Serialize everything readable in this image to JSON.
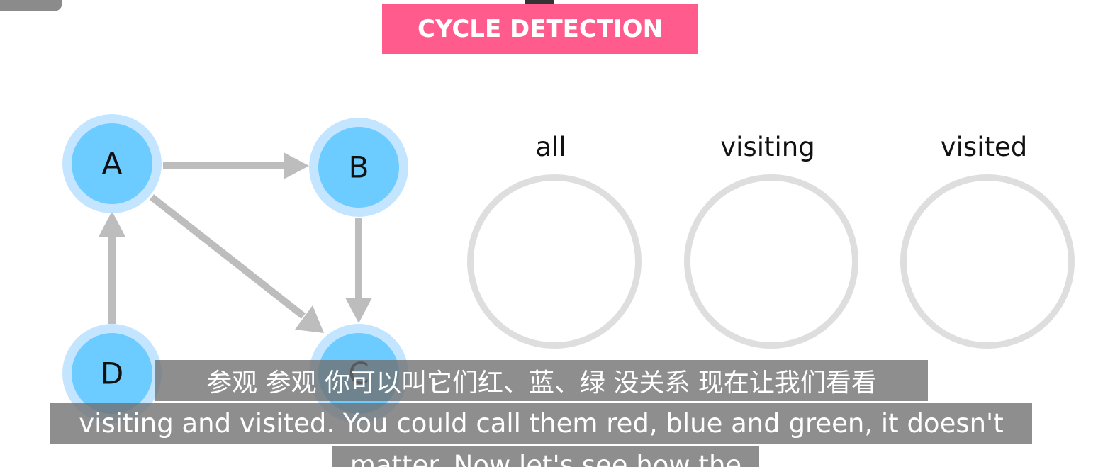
{
  "title": "CYCLE DETECTION",
  "colors": {
    "banner": "#ff5b8c",
    "node_fill": "#6ccbff",
    "node_halo": "#c4e5ff",
    "edge": "#bdbdbd",
    "set_ring": "#dedede"
  },
  "graph": {
    "nodes": [
      {
        "id": "A",
        "label": "A"
      },
      {
        "id": "B",
        "label": "B"
      },
      {
        "id": "C",
        "label": "C"
      },
      {
        "id": "D",
        "label": "D"
      }
    ],
    "edges": [
      {
        "from": "A",
        "to": "B"
      },
      {
        "from": "A",
        "to": "C"
      },
      {
        "from": "B",
        "to": "C"
      },
      {
        "from": "D",
        "to": "A"
      }
    ]
  },
  "sets": [
    {
      "label": "all"
    },
    {
      "label": "visiting"
    },
    {
      "label": "visited"
    }
  ],
  "subtitles": {
    "zh": "参观 参观 你可以叫它们红、蓝、绿 没关系 现在让我们看看",
    "en_line1": "visiting and visited. You could call them red, blue and green, it doesn't",
    "en_line2": "matter. Now let's see how the"
  }
}
